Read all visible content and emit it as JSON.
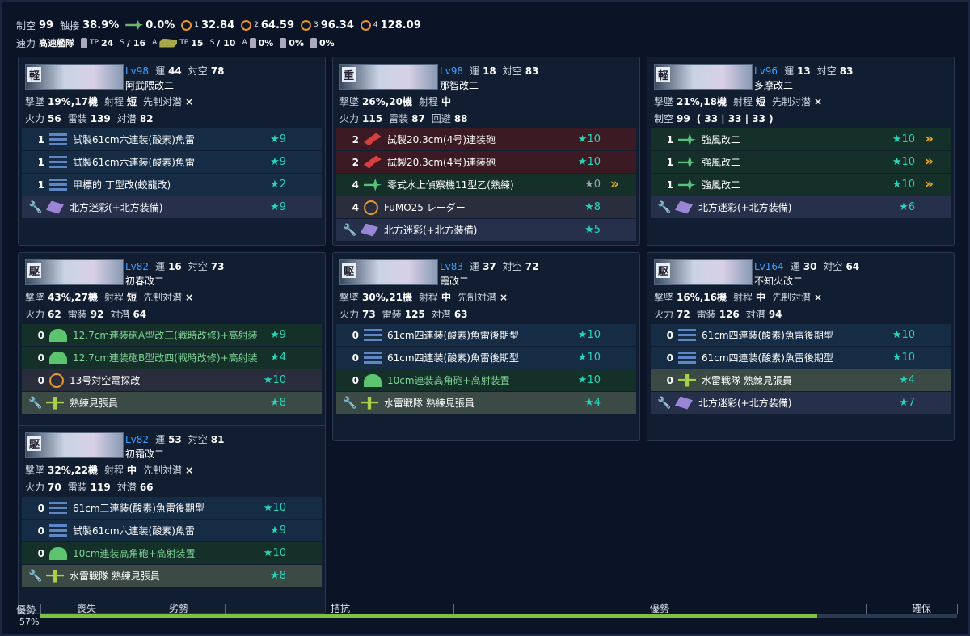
{
  "header": {
    "row1": [
      {
        "label": "制空",
        "value": "99"
      },
      {
        "label": "触接",
        "value": "38.9%"
      }
    ],
    "row1_icons": [
      {
        "icon": "plane-icon",
        "value": "0.0%"
      },
      {
        "icon": "radar-icon",
        "sub": "1",
        "value": "32.84"
      },
      {
        "icon": "radar-icon",
        "sub": "2",
        "value": "64.59"
      },
      {
        "icon": "radar-icon",
        "sub": "3",
        "value": "96.34"
      },
      {
        "icon": "radar-icon",
        "sub": "4",
        "value": "128.09"
      }
    ],
    "speed_label": "速力",
    "speed_value": "高速艦隊",
    "tp1": "24",
    "tp1_sub": "S",
    "tp1_slash": "/ 16",
    "tp1_sub2": "A",
    "tp2": "15",
    "tp2_sub": "S",
    "tp2_slash": "/ 10",
    "tp2_sub2": "A",
    "tp_label": "TP",
    "drum1": "0%",
    "drum2": "0%",
    "drum3": "0%"
  },
  "ships": [
    {
      "type": "軽",
      "lv": "Lv98",
      "luck_label": "運",
      "luck": "44",
      "aa_label": "対空",
      "aa": "78",
      "name": "阿武隈改二",
      "l2": [
        [
          "撃墜",
          "19%,17機"
        ],
        [
          "射程",
          "短"
        ],
        [
          "先制対潜",
          "×"
        ]
      ],
      "l3": [
        [
          "火力",
          "56"
        ],
        [
          "雷装",
          "139"
        ],
        [
          "対潜",
          "82"
        ]
      ],
      "equips": [
        {
          "cnt": "1",
          "icon": "torp",
          "name": "試製61cm六連装(酸素)魚雷",
          "star": "★9",
          "color": "blue"
        },
        {
          "cnt": "1",
          "icon": "torp",
          "name": "試製61cm六連装(酸素)魚雷",
          "star": "★9",
          "color": "blue"
        },
        {
          "cnt": "1",
          "icon": "torp",
          "name": "甲標的 丁型改(蛟龍改)",
          "star": "★2",
          "color": "blue"
        },
        {
          "cnt": "",
          "icon": "ammo",
          "name": "北方迷彩(+北方装備)",
          "star": "★9",
          "color": "ex",
          "ex": true
        }
      ]
    },
    {
      "type": "重",
      "lv": "Lv98",
      "luck_label": "運",
      "luck": "18",
      "aa_label": "対空",
      "aa": "83",
      "name": "那智改二",
      "l2": [
        [
          "撃墜",
          "26%,20機"
        ],
        [
          "射程",
          "中"
        ]
      ],
      "l3": [
        [
          "火力",
          "115"
        ],
        [
          "雷装",
          "87"
        ],
        [
          "回避",
          "88"
        ]
      ],
      "equips": [
        {
          "cnt": "2",
          "icon": "gun",
          "name": "試製20.3cm(4号)連装砲",
          "star": "★10",
          "color": "red"
        },
        {
          "cnt": "2",
          "icon": "gun",
          "name": "試製20.3cm(4号)連装砲",
          "star": "★10",
          "color": "red"
        },
        {
          "cnt": "4",
          "icon": "sea",
          "name": "零式水上偵察機11型乙(熟練)",
          "star": "★0",
          "color": "green",
          "grey": true,
          "prof": "»"
        },
        {
          "cnt": "4",
          "icon": "radar",
          "name": "FuMO25 レーダー",
          "star": "★8",
          "color": "gray"
        },
        {
          "cnt": "",
          "icon": "ammo",
          "name": "北方迷彩(+北方装備)",
          "star": "★5",
          "color": "ex",
          "ex": true
        }
      ]
    },
    {
      "type": "軽",
      "lv": "Lv96",
      "luck_label": "運",
      "luck": "13",
      "aa_label": "対空",
      "aa": "83",
      "name": "多摩改二",
      "l2": [
        [
          "撃墜",
          "21%,18機"
        ],
        [
          "射程",
          "短"
        ],
        [
          "先制対潜",
          "×"
        ]
      ],
      "l3": [
        [
          "制空",
          "99"
        ],
        [
          "",
          "( 33 | 33 | 33 )"
        ]
      ],
      "equips": [
        {
          "cnt": "1",
          "icon": "sea",
          "name": "強風改二",
          "star": "★10",
          "color": "green",
          "prof": "»"
        },
        {
          "cnt": "1",
          "icon": "sea",
          "name": "強風改二",
          "star": "★10",
          "color": "green",
          "prof": "»"
        },
        {
          "cnt": "1",
          "icon": "sea",
          "name": "強風改二",
          "star": "★10",
          "color": "green",
          "prof": "»"
        },
        {
          "cnt": "",
          "icon": "ammo",
          "name": "北方迷彩(+北方装備)",
          "star": "★6",
          "color": "ex",
          "ex": true
        }
      ]
    },
    {
      "type": "駆",
      "lv": "Lv82",
      "luck_label": "運",
      "luck": "16",
      "aa_label": "対空",
      "aa": "73",
      "name": "初春改二",
      "l2": [
        [
          "撃墜",
          "43%,27機"
        ],
        [
          "射程",
          "短"
        ],
        [
          "先制対潜",
          "×"
        ]
      ],
      "l3": [
        [
          "火力",
          "62"
        ],
        [
          "雷装",
          "92"
        ],
        [
          "対潜",
          "64"
        ]
      ],
      "equips": [
        {
          "cnt": "0",
          "icon": "aa",
          "name": "12.7cm連装砲A型改三(戦時改修)+高射装",
          "star": "★9",
          "color": "green",
          "g": true
        },
        {
          "cnt": "0",
          "icon": "aa",
          "name": "12.7cm連装砲B型改四(戦時改修)+高射装",
          "star": "★4",
          "color": "green",
          "g": true
        },
        {
          "cnt": "0",
          "icon": "radar",
          "name": "13号対空電探改",
          "star": "★10",
          "color": "gray"
        },
        {
          "cnt": "",
          "icon": "look",
          "name": "熟練見張員",
          "star": "★8",
          "color": "greenlite",
          "ex": true
        }
      ]
    },
    {
      "type": "駆",
      "lv": "Lv83",
      "luck_label": "運",
      "luck": "37",
      "aa_label": "対空",
      "aa": "72",
      "name": "霞改二",
      "l2": [
        [
          "撃墜",
          "30%,21機"
        ],
        [
          "射程",
          "中"
        ],
        [
          "先制対潜",
          "×"
        ]
      ],
      "l3": [
        [
          "火力",
          "73"
        ],
        [
          "雷装",
          "125"
        ],
        [
          "対潜",
          "63"
        ]
      ],
      "equips": [
        {
          "cnt": "0",
          "icon": "torp",
          "name": "61cm四連装(酸素)魚雷後期型",
          "star": "★10",
          "color": "blue"
        },
        {
          "cnt": "0",
          "icon": "torp",
          "name": "61cm四連装(酸素)魚雷後期型",
          "star": "★10",
          "color": "blue"
        },
        {
          "cnt": "0",
          "icon": "aa",
          "name": "10cm連装高角砲+高射装置",
          "star": "★10",
          "color": "green",
          "g": true
        },
        {
          "cnt": "",
          "icon": "look",
          "name": "水雷戦隊 熟練見張員",
          "star": "★4",
          "color": "greenlite",
          "ex": true
        }
      ]
    },
    {
      "type": "駆",
      "lv": "Lv164",
      "luck_label": "運",
      "luck": "30",
      "aa_label": "対空",
      "aa": "64",
      "name": "不知火改二",
      "l2": [
        [
          "撃墜",
          "16%,16機"
        ],
        [
          "射程",
          "中"
        ],
        [
          "先制対潜",
          "×"
        ]
      ],
      "l3": [
        [
          "火力",
          "72"
        ],
        [
          "雷装",
          "126"
        ],
        [
          "対潜",
          "94"
        ]
      ],
      "equips": [
        {
          "cnt": "0",
          "icon": "torp",
          "name": "61cm四連装(酸素)魚雷後期型",
          "star": "★10",
          "color": "blue"
        },
        {
          "cnt": "0",
          "icon": "torp",
          "name": "61cm四連装(酸素)魚雷後期型",
          "star": "★10",
          "color": "blue"
        },
        {
          "cnt": "0",
          "icon": "look",
          "name": "水雷戦隊 熟練見張員",
          "star": "★4",
          "color": "greenlite"
        },
        {
          "cnt": "",
          "icon": "ammo",
          "name": "北方迷彩(+北方装備)",
          "star": "★7",
          "color": "ex",
          "ex": true
        }
      ]
    },
    {
      "type": "駆",
      "lv": "Lv82",
      "luck_label": "運",
      "luck": "53",
      "aa_label": "対空",
      "aa": "81",
      "name": "初霜改二",
      "l2": [
        [
          "撃墜",
          "32%,22機"
        ],
        [
          "射程",
          "中"
        ],
        [
          "先制対潜",
          "×"
        ]
      ],
      "l3": [
        [
          "火力",
          "70"
        ],
        [
          "雷装",
          "119"
        ],
        [
          "対潜",
          "66"
        ]
      ],
      "equips": [
        {
          "cnt": "0",
          "icon": "torp",
          "name": "61cm三連装(酸素)魚雷後期型",
          "star": "★10",
          "color": "blue"
        },
        {
          "cnt": "0",
          "icon": "torp",
          "name": "試製61cm六連装(酸素)魚雷",
          "star": "★9",
          "color": "blue"
        },
        {
          "cnt": "0",
          "icon": "aa",
          "name": "10cm連装高角砲+高射装置",
          "star": "★10",
          "color": "green",
          "g": true
        },
        {
          "cnt": "",
          "icon": "look",
          "name": "水雷戦隊 熟練見張員",
          "star": "★8",
          "color": "greenlite",
          "ex": true
        }
      ]
    }
  ],
  "airbar": {
    "left_label": "優勢",
    "percent": "57%",
    "fill_fraction": 0.85,
    "labels": [
      "喪失",
      "劣勢",
      "拮抗",
      "優勢",
      "確保"
    ]
  }
}
